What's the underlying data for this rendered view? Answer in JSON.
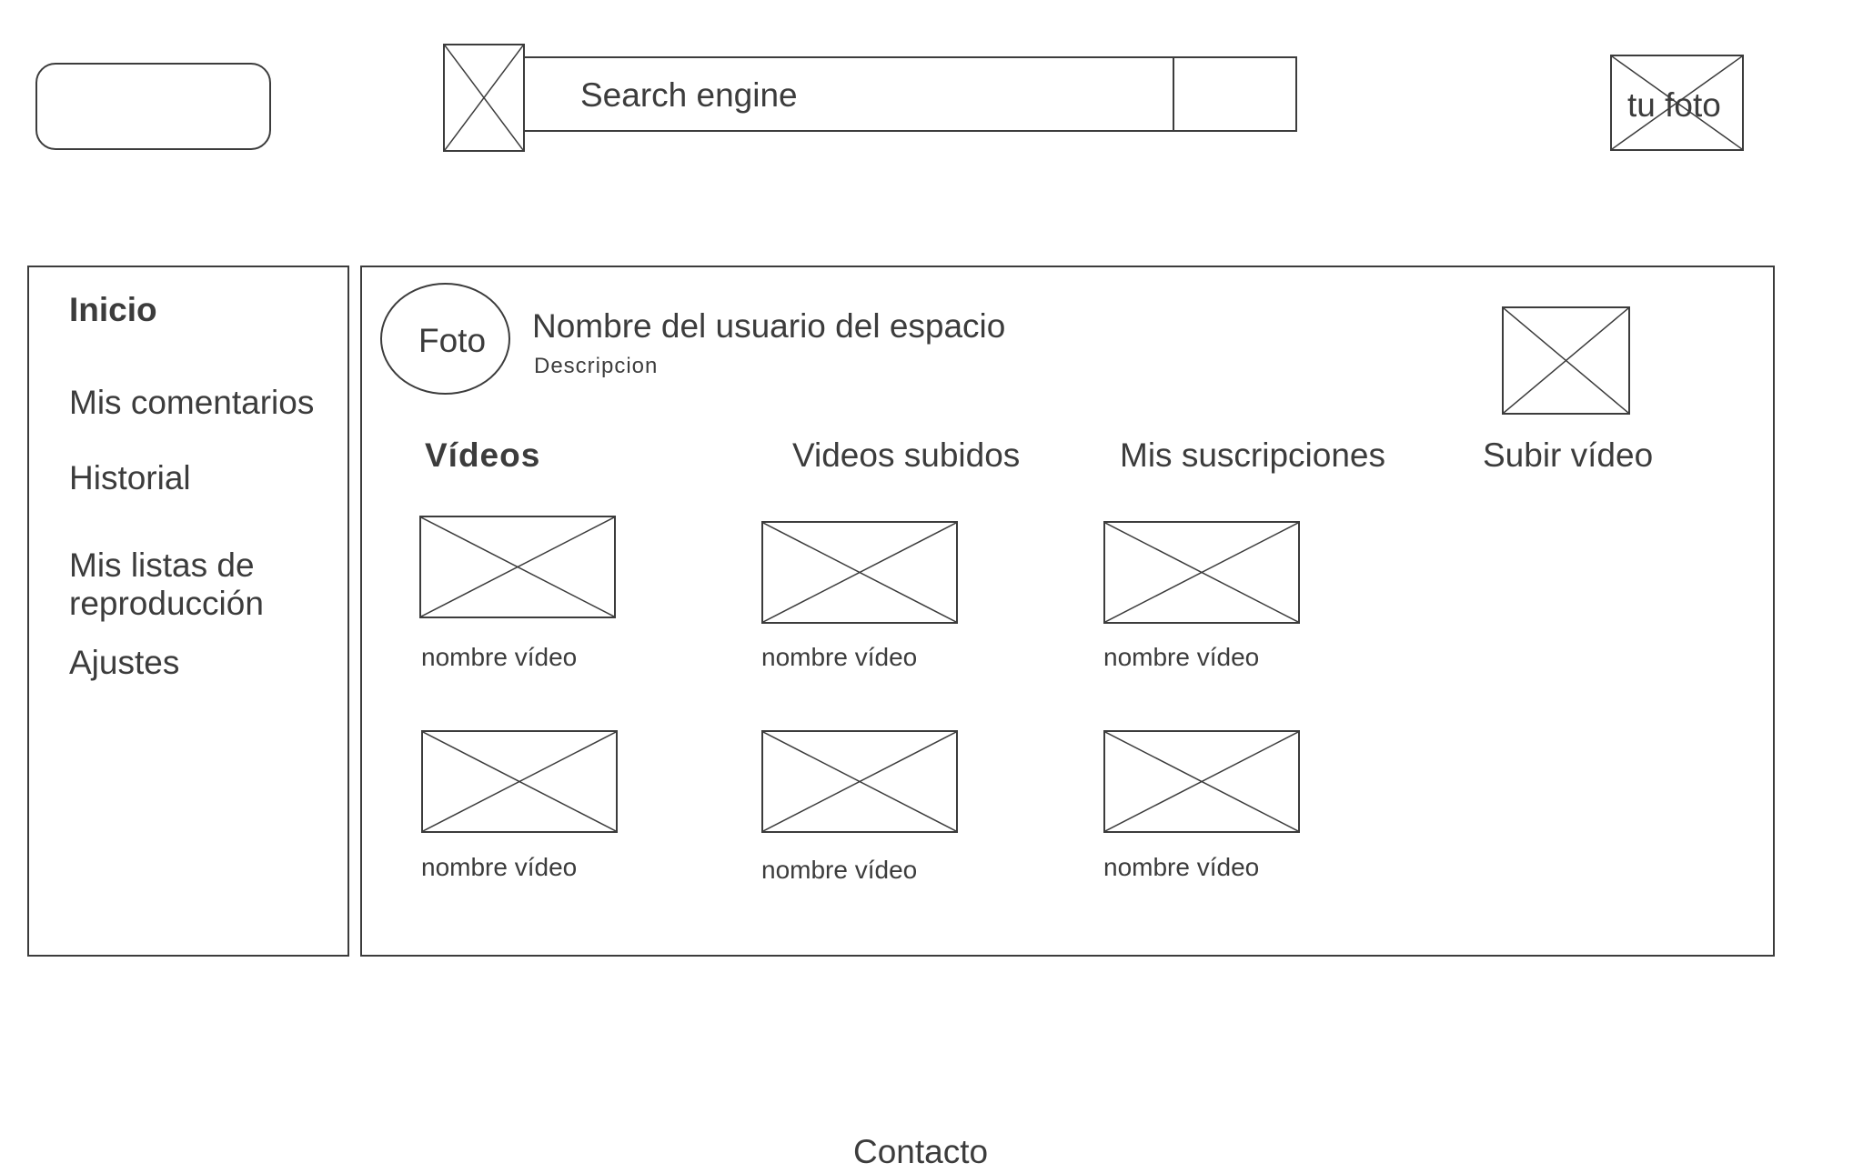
{
  "search": {
    "placeholder": "Search engine"
  },
  "header": {
    "avatar_label": "tu foto"
  },
  "sidebar": {
    "items": [
      {
        "label": "Inicio"
      },
      {
        "label": "Mis comentarios"
      },
      {
        "label": "Historial"
      },
      {
        "label": "Mis listas de reproducción"
      },
      {
        "label": "Ajustes"
      }
    ]
  },
  "channel": {
    "photo_label": "Foto",
    "name": "Nombre del usuario del espacio",
    "description": "Descripcion"
  },
  "tabs": [
    {
      "label": "Vídeos",
      "active": true
    },
    {
      "label": "Videos subidos"
    },
    {
      "label": "Mis suscripciones"
    },
    {
      "label": "Subir vídeo"
    }
  ],
  "videos": [
    {
      "title": "nombre vídeo"
    },
    {
      "title": "nombre vídeo"
    },
    {
      "title": "nombre vídeo"
    },
    {
      "title": "nombre vídeo"
    },
    {
      "title": "nombre vídeo"
    },
    {
      "title": "nombre vídeo"
    }
  ],
  "footer": {
    "contact_label": "Contacto"
  }
}
